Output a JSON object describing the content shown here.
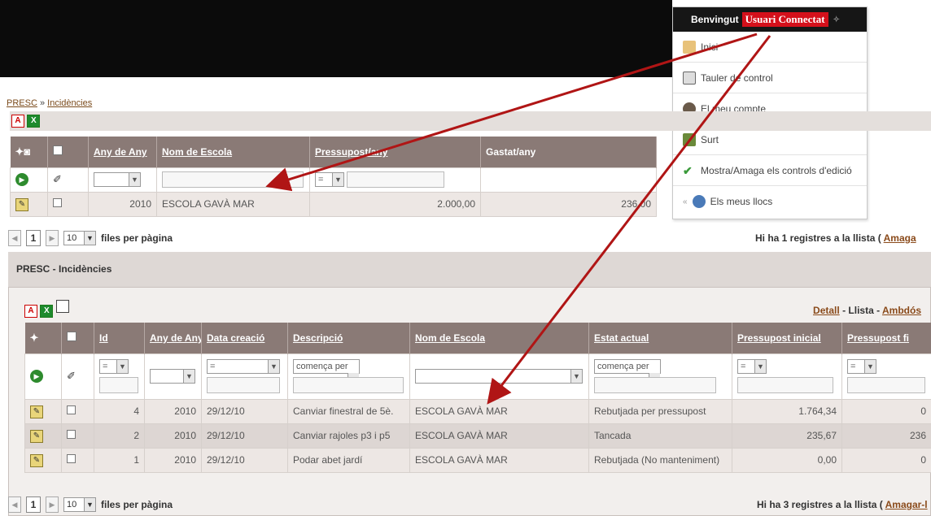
{
  "user_menu": {
    "greeting": "Benvingut",
    "user_name": "Usuari Connectat",
    "items": [
      {
        "label": "Inici",
        "icon": "home-icon"
      },
      {
        "label": "Tauler de control",
        "icon": "dashboard-icon"
      },
      {
        "label": "El meu compte",
        "icon": "user-icon"
      },
      {
        "label": "Surt",
        "icon": "logout-icon"
      },
      {
        "label": "Mostra/Amaga els controls d'edició",
        "icon": "check-icon"
      },
      {
        "label": "Els meus llocs",
        "icon": "sites-icon"
      }
    ]
  },
  "breadcrumb": {
    "root": "PRESC",
    "sep": "»",
    "current": "Incidències"
  },
  "top_table": {
    "columns": [
      "Any de Any",
      "Nom de Escola",
      "Pressupost/any",
      "Gastat/any"
    ],
    "filter": {
      "eq": "="
    },
    "row": {
      "any": "2010",
      "escola": "ESCOLA GAVÀ MAR",
      "pressupost": "2.000,00",
      "gastat": "236,00"
    }
  },
  "top_pager": {
    "page": "1",
    "per_page": "10",
    "per_page_label": "files per pàgina",
    "count_text": "Hi ha 1 registres a la llista (",
    "hide_link": "Amaga"
  },
  "panel": {
    "title": "PRESC - Incidències",
    "view_detail": "Detall",
    "view_list": "Llista",
    "view_both": "Ambdós",
    "sep": "-"
  },
  "bottom_table": {
    "columns": [
      "Id",
      "Any de Any",
      "Data creació",
      "Descripció",
      "Nom de Escola",
      "Estat actual",
      "Pressupost inicial",
      "Pressupost fi"
    ],
    "filter": {
      "eq": "=",
      "starts": "comença per"
    },
    "rows": [
      {
        "id": "4",
        "any": "2010",
        "data": "29/12/10",
        "desc": "Canviar finestral de 5è.",
        "escola": "ESCOLA GAVÀ MAR",
        "estat": "Rebutjada per pressupost",
        "inicial": "1.764,34",
        "final": "0"
      },
      {
        "id": "2",
        "any": "2010",
        "data": "29/12/10",
        "desc": "Canviar rajoles p3 i p5",
        "escola": "ESCOLA GAVÀ MAR",
        "estat": "Tancada",
        "inicial": "235,67",
        "final": "236"
      },
      {
        "id": "1",
        "any": "2010",
        "data": "29/12/10",
        "desc": "Podar abet jardí",
        "escola": "ESCOLA GAVÀ MAR",
        "estat": "Rebutjada (No manteniment)",
        "inicial": "0,00",
        "final": "0"
      }
    ]
  },
  "bottom_pager": {
    "page": "1",
    "per_page": "10",
    "per_page_label": "files per pàgina",
    "count_text": "Hi ha 3 registres a la llista (",
    "hide_link": "Amagar-l"
  },
  "colors": {
    "accent_red": "#d4101b",
    "header_bg": "#8a7a76",
    "arrow": "#b01515"
  }
}
